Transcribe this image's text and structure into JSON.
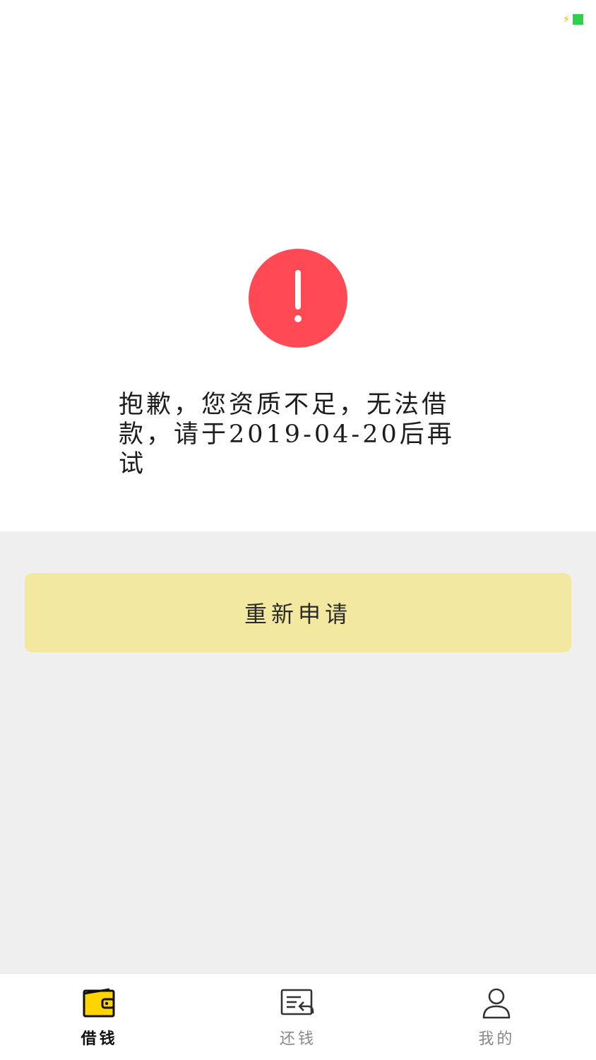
{
  "status_bar": {
    "battery_icon": "battery-charging-icon",
    "battery_color": "#2bd24a",
    "bolt_color": "#f2c200"
  },
  "result": {
    "icon": "alert-exclamation-icon",
    "icon_color": "#ff4a55",
    "message": "抱歉，您资质不足，无法借款，请于2019-04-20后再试"
  },
  "actions": {
    "reapply_label": "重新申请",
    "button_color": "#f2e8a0"
  },
  "tabbar": {
    "tabs": [
      {
        "label": "借钱",
        "icon": "wallet-icon",
        "active": true
      },
      {
        "label": "还钱",
        "icon": "repay-document-icon",
        "active": false
      },
      {
        "label": "我的",
        "icon": "user-icon",
        "active": false
      }
    ]
  },
  "colors": {
    "accent": "#ffd400",
    "gray_bg": "#efefef"
  }
}
